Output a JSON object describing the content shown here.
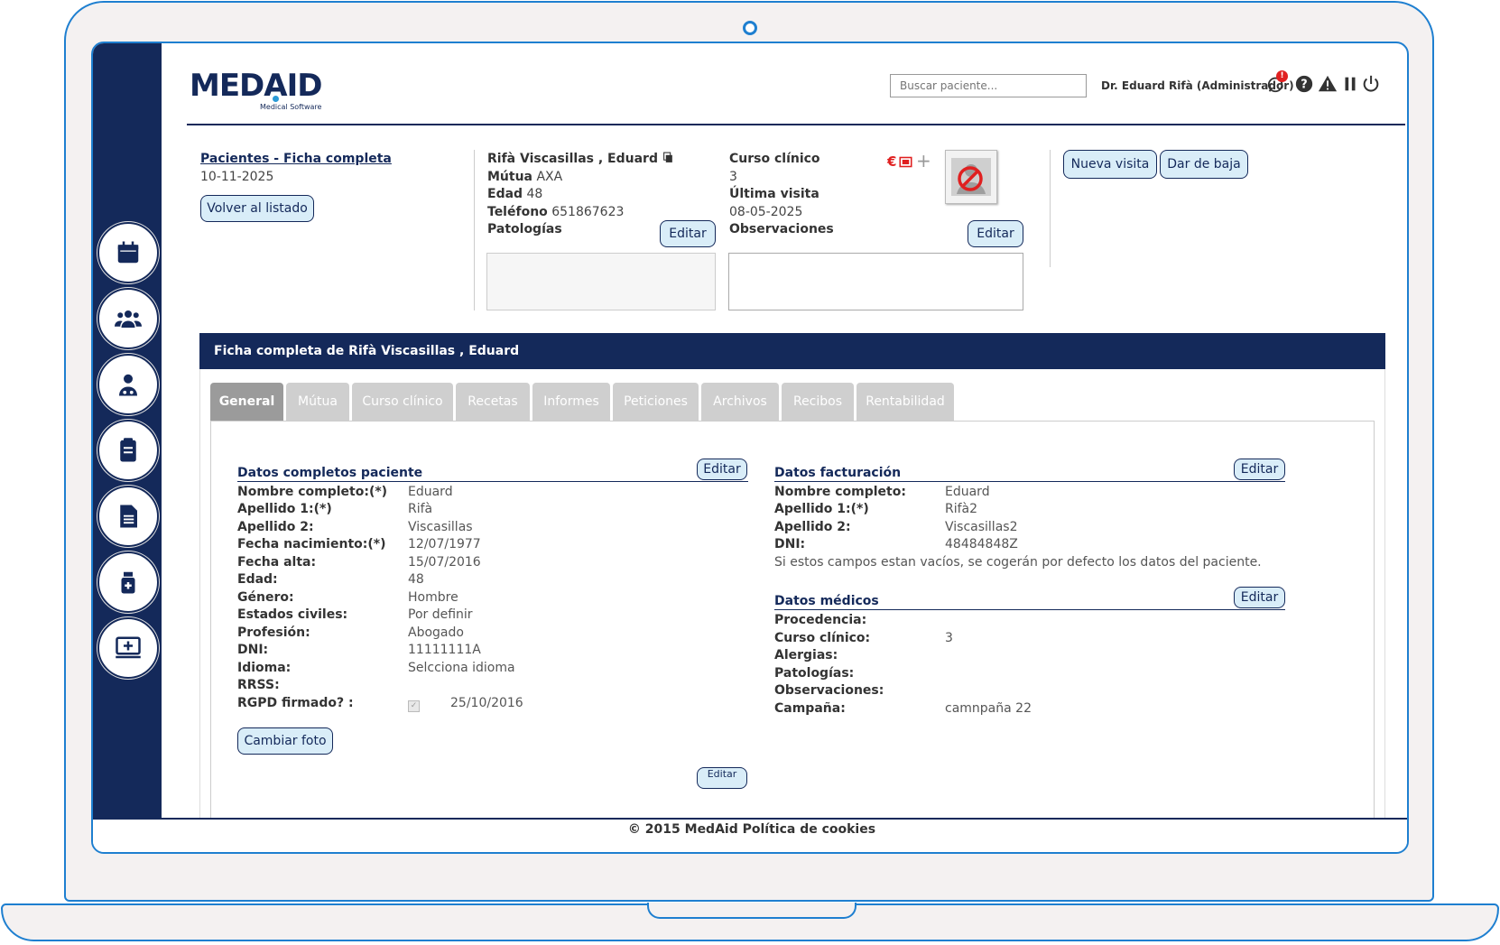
{
  "brand": {
    "name": "MEDAID",
    "subtitle": "Medical Software"
  },
  "header": {
    "search_placeholder": "Buscar paciente...",
    "user": "Dr. Eduard Rifà (Administrador)",
    "notification_count": "!"
  },
  "top_left": {
    "title": "Pacientes - Ficha completa",
    "date": "10-11-2025",
    "back_button": "Volver al listado"
  },
  "patient": {
    "name": "Rifà Viscasillas , Eduard",
    "mutua_label": "Mútua",
    "mutua_value": "AXA",
    "edad_label": "Edad",
    "edad_value": "48",
    "telefono_label": "Teléfono",
    "telefono_value": "651867623",
    "patologias_label": "Patologías",
    "edit_button": "Editar"
  },
  "clinical": {
    "curso_label": "Curso clínico",
    "curso_value": "3",
    "ultima_label": "Última visita",
    "ultima_value": "08-05-2025",
    "observaciones_label": "Observaciones",
    "edit_button": "Editar",
    "plus": "+"
  },
  "actions": {
    "nueva_visita": "Nueva visita",
    "dar_de_baja": "Dar de baja"
  },
  "panel": {
    "title": "Ficha completa de Rifà Viscasillas , Eduard"
  },
  "tabs": [
    {
      "label": "General"
    },
    {
      "label": "Mútua"
    },
    {
      "label": "Curso clínico"
    },
    {
      "label": "Recetas"
    },
    {
      "label": "Informes"
    },
    {
      "label": "Peticiones"
    },
    {
      "label": "Archivos"
    },
    {
      "label": "Recibos"
    },
    {
      "label": "Rentabilidad"
    }
  ],
  "datos_paciente": {
    "title": "Datos completos paciente",
    "edit_button": "Editar",
    "rows": [
      {
        "label": "Nombre completo:(*)",
        "value": "Eduard"
      },
      {
        "label": "Apellido 1:(*)",
        "value": "Rifà"
      },
      {
        "label": "Apellido 2:",
        "value": "Viscasillas"
      },
      {
        "label": "Fecha nacimiento:(*)",
        "value": "12/07/1977"
      },
      {
        "label": "Fecha alta:",
        "value": "15/07/2016"
      },
      {
        "label": "Edad:",
        "value": "48"
      },
      {
        "label": "Género:",
        "value": "Hombre"
      },
      {
        "label": "Estados civiles:",
        "value": "Por definir"
      },
      {
        "label": "Profesión:",
        "value": "Abogado"
      },
      {
        "label": "DNI:",
        "value": "11111111A"
      },
      {
        "label": "Idioma:",
        "value": "Selcciona idioma"
      },
      {
        "label": "RRSS:",
        "value": ""
      },
      {
        "label": "RGPD firmado? :",
        "value": "25/10/2016"
      }
    ],
    "photo_button": "Cambiar foto",
    "partial_button": "Editar"
  },
  "datos_facturacion": {
    "title": "Datos facturación",
    "edit_button": "Editar",
    "rows": [
      {
        "label": "Nombre completo:",
        "value": "Eduard"
      },
      {
        "label": "Apellido 1:(*)",
        "value": "Rifà2"
      },
      {
        "label": "Apellido 2:",
        "value": "Viscasillas2"
      },
      {
        "label": "DNI:",
        "value": "48484848Z"
      }
    ],
    "note": "Si estos campos estan vacíos, se cogerán por defecto los datos del paciente."
  },
  "datos_medicos": {
    "title": "Datos médicos",
    "edit_button": "Editar",
    "rows": [
      {
        "label": "Procedencia:",
        "value": ""
      },
      {
        "label": "Curso clínico:",
        "value": "3"
      },
      {
        "label": "Alergias:",
        "value": ""
      },
      {
        "label": "Patologías:",
        "value": ""
      },
      {
        "label": "Observaciones:",
        "value": ""
      },
      {
        "label": "Campaña:",
        "value": "camnpaña 22"
      }
    ]
  },
  "footer": {
    "text": "© 2015 MedAid Política de cookies"
  },
  "colors": {
    "navy": "#14295a",
    "frame_blue": "#1e7fd0",
    "button_bg": "#d9edf8",
    "alert_red": "#e02020"
  }
}
